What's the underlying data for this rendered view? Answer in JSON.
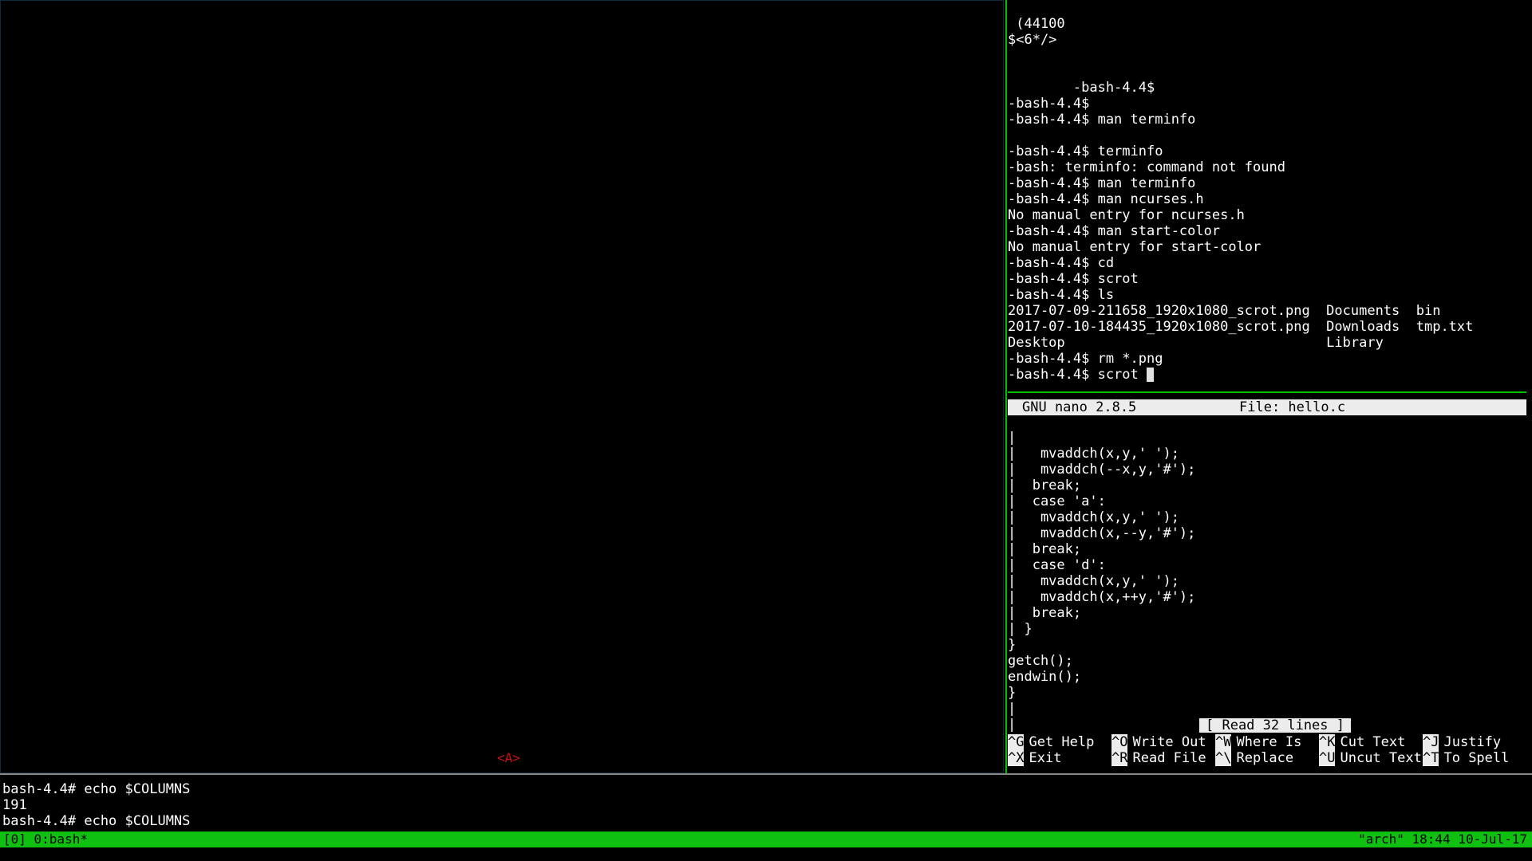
{
  "colors": {
    "pane_border_active": "#00c000",
    "status_bg": "#10c010",
    "marker": "#cc1010"
  },
  "left_pane": {
    "marker": "<A>"
  },
  "shell": {
    "lines": [
      " (44100",
      "$<6*/>",
      "",
      "",
      "        -bash-4.4$",
      "-bash-4.4$",
      "-bash-4.4$ man terminfo",
      "",
      "-bash-4.4$ terminfo",
      "-bash: terminfo: command not found",
      "-bash-4.4$ man terminfo",
      "-bash-4.4$ man ncurses.h",
      "No manual entry for ncurses.h",
      "-bash-4.4$ man start-color",
      "No manual entry for start-color",
      "-bash-4.4$ cd",
      "-bash-4.4$ scrot",
      "-bash-4.4$ ls",
      "2017-07-09-211658_1920x1080_scrot.png  Documents  bin",
      "2017-07-10-184435_1920x1080_scrot.png  Downloads  tmp.txt",
      "Desktop                                Library",
      "-bash-4.4$ rm *.png"
    ],
    "current_prompt": "-bash-4.4$ scrot"
  },
  "nano": {
    "version": "GNU nano 2.8.5",
    "file": "File: hello.c",
    "code_lines": [
      "|",
      "|   mvaddch(x,y,' ');",
      "|   mvaddch(--x,y,'#');",
      "|  break;",
      "|  case 'a':",
      "|   mvaddch(x,y,' ');",
      "|   mvaddch(x,--y,'#');",
      "|  break;",
      "|  case 'd':",
      "|   mvaddch(x,y,' ');",
      "|   mvaddch(x,++y,'#');",
      "|  break;",
      "| }",
      "}",
      "getch();",
      "endwin();",
      "}",
      "|",
      "|"
    ],
    "status": "[ Read 32 lines ]",
    "shortcuts_row1": [
      {
        "key": "^G",
        "label": "Get Help"
      },
      {
        "key": "^O",
        "label": "Write Out"
      },
      {
        "key": "^W",
        "label": "Where Is"
      },
      {
        "key": "^K",
        "label": "Cut Text"
      },
      {
        "key": "^J",
        "label": "Justify"
      }
    ],
    "shortcuts_row2": [
      {
        "key": "^X",
        "label": "Exit"
      },
      {
        "key": "^R",
        "label": "Read File"
      },
      {
        "key": "^\\",
        "label": "Replace"
      },
      {
        "key": "^U",
        "label": "Uncut Text"
      },
      {
        "key": "^T",
        "label": "To Spell"
      }
    ]
  },
  "bottom_shell": {
    "lines": [
      "bash-4.4# echo $COLUMNS",
      "191",
      "bash-4.4# echo $COLUMNS"
    ]
  },
  "tmux_status": {
    "left": "[0] 0:bash*",
    "right": "\"arch\" 18:44 10-Jul-17"
  }
}
